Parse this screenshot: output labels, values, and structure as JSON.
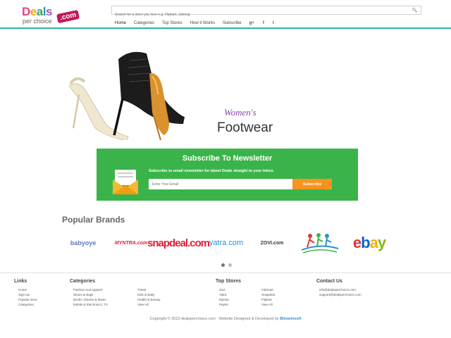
{
  "logo": {
    "deals_d": "D",
    "deals_e": "e",
    "deals_a": "a",
    "deals_l": "l",
    "deals_s": "s",
    "per_choice": "per choice",
    "dotcom": ".com"
  },
  "search": {
    "placeholder": "Search for a store you love e.g. Flipkart, Jabong"
  },
  "nav": {
    "items": [
      "Home",
      "Categories",
      "Top Stores",
      "How it Works",
      "Subscribe"
    ],
    "social": [
      "g+",
      "f",
      "t"
    ]
  },
  "hero": {
    "subtitle": "Women's",
    "title": "Footwear"
  },
  "newsletter": {
    "title": "Subscribe To Newsletter",
    "description": "Subscribe to email newsletter for latest Deals straight to your Inbox.",
    "input_placeholder": "Enter Your Email",
    "button": "Subscribe"
  },
  "brands": {
    "title": "Popular Brands",
    "items": [
      "babyoye",
      "MYNTRA.com",
      "snapdeal.com",
      "yatra.com",
      "ZOVI.com",
      "ebay"
    ],
    "tickets_logo": "ticket-figures",
    "carousel_pages": 2,
    "carousel_active": 1
  },
  "footer": {
    "links": {
      "title": "Links",
      "items": [
        "Home",
        "Sign Up",
        "Popular store",
        "Categories"
      ]
    },
    "categories": {
      "title": "Categories",
      "col1": [
        "Fashion And Apparel",
        "Shoes & Bags",
        "Books, Movies & Music",
        "Mobile & Electronics, TV"
      ],
      "col2": [
        "Travel",
        "Kids & Baby",
        "Health & Beauty",
        "View All"
      ]
    },
    "top_stores": {
      "title": "Top Stores",
      "col1": [
        "Zovi",
        "Yatra",
        "Myntra",
        "Paytm"
      ],
      "col2": [
        "Fabmart",
        "Snapdeal",
        "Flipkart",
        "View All"
      ]
    },
    "contact": {
      "title": "Contact Us",
      "items": [
        "info@dealsperchoice.com",
        "support@dealsperchoice.com"
      ]
    },
    "copyright": "Copyright © 2015 dealsperchoice.com · Website Designed & Developed by",
    "developer": "Bitsteinsoft"
  },
  "colors": {
    "accent": "#2bb3a3",
    "newsletter_bg": "#3ab44a",
    "button": "#f7941d"
  }
}
